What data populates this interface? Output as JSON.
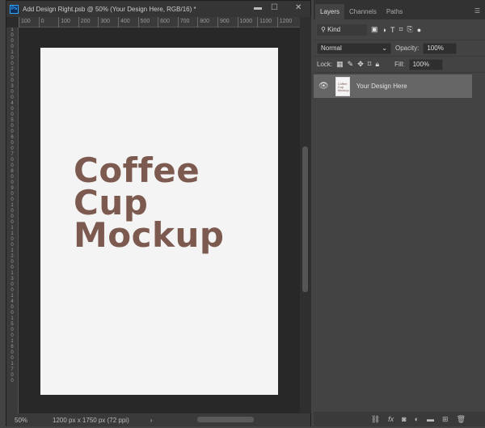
{
  "document": {
    "title": "Add Design Right.psb @ 50% (Your Design Here, RGB/16) *",
    "ruler_h": [
      "100",
      "0",
      "100",
      "200",
      "300",
      "400",
      "500",
      "600",
      "700",
      "800",
      "900",
      "1000",
      "1100",
      "1200"
    ],
    "ruler_v": [
      "1",
      "0",
      "0",
      "0",
      "1",
      "0",
      "0",
      "2",
      "0",
      "0",
      "3",
      "0",
      "0",
      "4",
      "0",
      "0",
      "5",
      "0",
      "0",
      "6",
      "0",
      "0",
      "7",
      "0",
      "0",
      "8",
      "0",
      "0",
      "9",
      "0",
      "0",
      "1",
      "0",
      "0",
      "0",
      "1",
      "1",
      "0",
      "0",
      "1",
      "2",
      "0",
      "0",
      "1",
      "3",
      "0",
      "0",
      "1",
      "4",
      "0",
      "0",
      "1",
      "5",
      "0",
      "0",
      "1",
      "6",
      "0",
      "0",
      "1",
      "7",
      "0",
      "0"
    ],
    "headline": [
      "Coffee",
      "Cup",
      "Mockup"
    ],
    "zoom": "50%",
    "dimensions": "1200 px x 1750 px (72 ppi)"
  },
  "panel": {
    "tabs": [
      "Layers",
      "Channels",
      "Paths"
    ],
    "filter": "Kind",
    "blend_mode": "Normal",
    "opacity_label": "Opacity:",
    "opacity": "100%",
    "lock_label": "Lock:",
    "fill_label": "Fill:",
    "fill": "100%",
    "layers": [
      {
        "name": "Your Design Here",
        "thumb": "Coffee Cup Mockup"
      }
    ]
  },
  "colors": {
    "headline": "#7d5a4f"
  }
}
